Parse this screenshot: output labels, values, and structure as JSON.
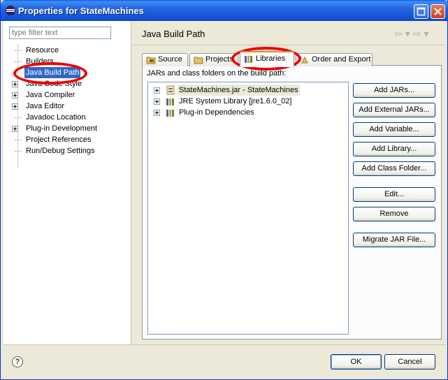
{
  "window": {
    "title": "Properties for StateMachines"
  },
  "left": {
    "filter_placeholder": "type filter text",
    "tree": [
      {
        "label": "Resource",
        "expandable": false,
        "selected": false
      },
      {
        "label": "Builders",
        "expandable": false,
        "selected": false
      },
      {
        "label": "Java Build Path",
        "expandable": false,
        "selected": true
      },
      {
        "label": "Java Code Style",
        "expandable": true,
        "selected": false
      },
      {
        "label": "Java Compiler",
        "expandable": true,
        "selected": false
      },
      {
        "label": "Java Editor",
        "expandable": true,
        "selected": false
      },
      {
        "label": "Javadoc Location",
        "expandable": false,
        "selected": false
      },
      {
        "label": "Plug-in Development",
        "expandable": true,
        "selected": false
      },
      {
        "label": "Project References",
        "expandable": false,
        "selected": false
      },
      {
        "label": "Run/Debug Settings",
        "expandable": false,
        "selected": false
      }
    ]
  },
  "main": {
    "title": "Java Build Path",
    "tabs": [
      {
        "label": "Source"
      },
      {
        "label": "Projects"
      },
      {
        "label": "Libraries"
      },
      {
        "label": "Order and Export"
      }
    ],
    "list_label": "JARs and class folders on the build path:",
    "entries": [
      {
        "label": "StateMachines.jar - StateMachines"
      },
      {
        "label": "JRE System Library [jre1.6.0_02]"
      },
      {
        "label": "Plug-in Dependencies"
      }
    ],
    "buttons": {
      "add_jars": "Add JARs...",
      "add_external_jars": "Add External JARs...",
      "add_variable": "Add Variable...",
      "add_library": "Add Library...",
      "add_class_folder": "Add Class Folder...",
      "edit": "Edit...",
      "remove": "Remove",
      "migrate_jar": "Migrate JAR File..."
    }
  },
  "footer": {
    "ok": "OK",
    "cancel": "Cancel",
    "help": "?"
  },
  "colors": {
    "selection": "#316ac5",
    "annotation": "#ee0000",
    "titlebar": "#0a5fe8"
  }
}
